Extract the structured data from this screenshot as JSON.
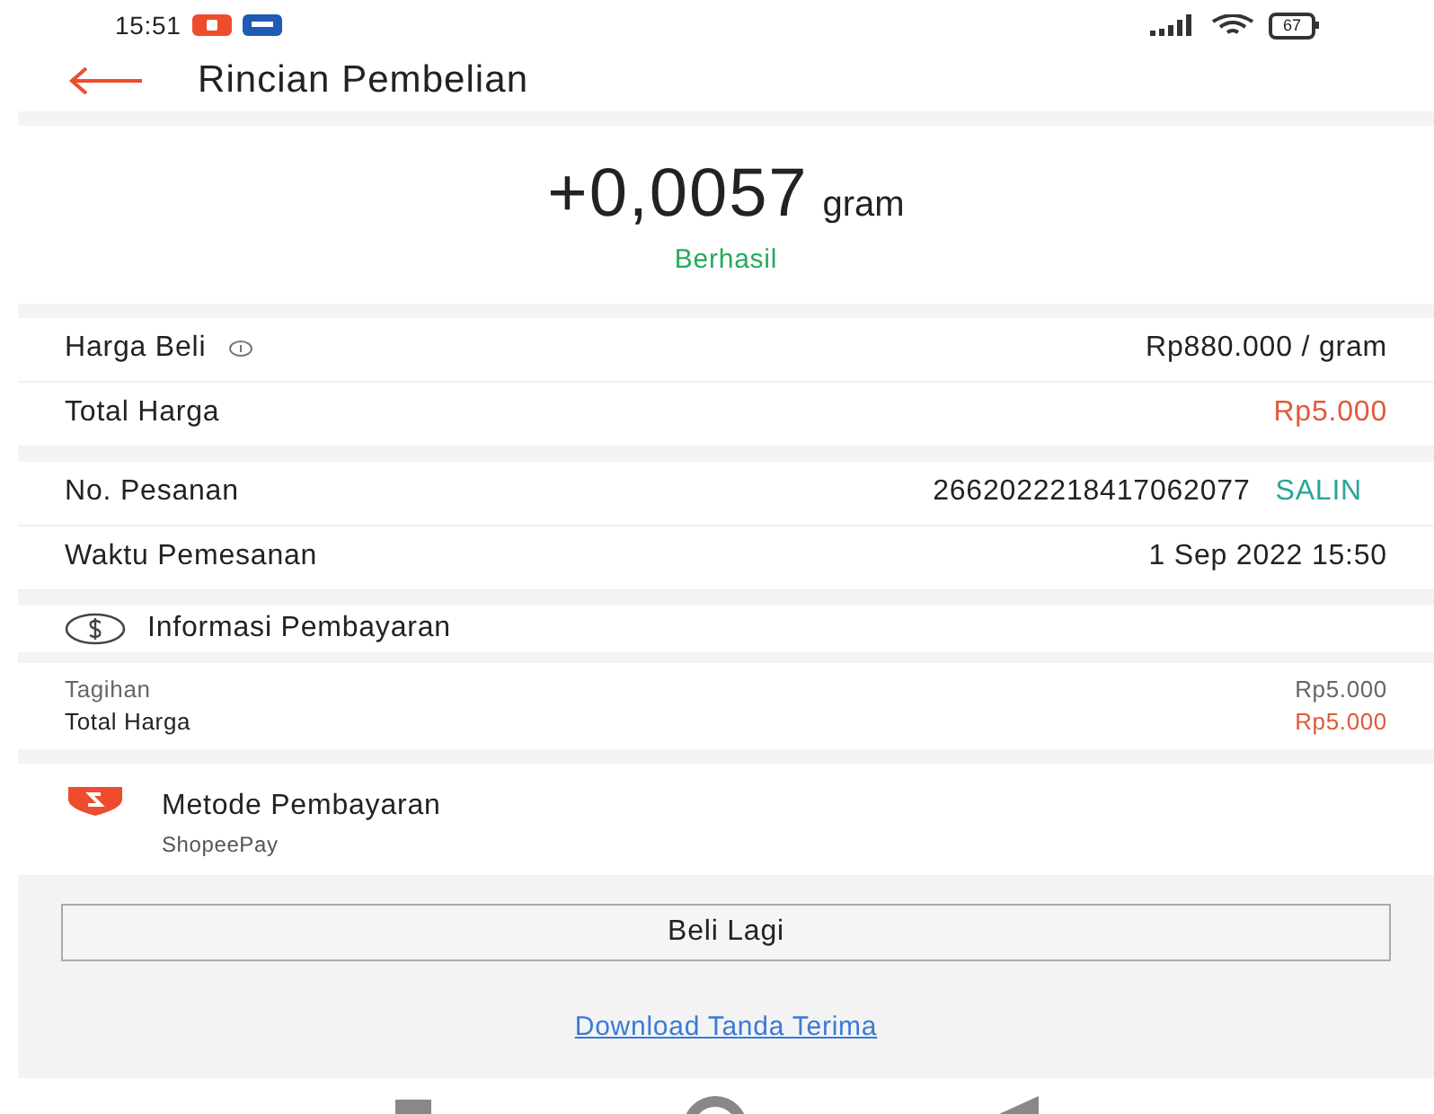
{
  "status_bar": {
    "time": "15:51",
    "battery": "67"
  },
  "header": {
    "title": "Rincian Pembelian"
  },
  "summary": {
    "amount": "+0,0057",
    "unit": "gram",
    "status": "Berhasil"
  },
  "price_rows": [
    {
      "label": "Harga Beli",
      "info": true,
      "value": "Rp880.000 / gram",
      "highlight": false
    },
    {
      "label": "Total Harga",
      "info": false,
      "value": "Rp5.000",
      "highlight": true
    }
  ],
  "order_rows": [
    {
      "label": "No. Pesanan",
      "value": "2662022218417062077",
      "action": "SALIN"
    },
    {
      "label": "Waktu Pemesanan",
      "value": "1 Sep 2022 15:50"
    }
  ],
  "payment_info": {
    "title": "Informasi Pembayaran",
    "rows": [
      {
        "label": "Tagihan",
        "value": "Rp5.000",
        "highlight": false
      },
      {
        "label": "Total Harga",
        "value": "Rp5.000",
        "highlight": true
      }
    ]
  },
  "payment_method": {
    "title": "Metode Pembayaran",
    "value": "ShopeePay"
  },
  "buy_again_button": "Beli Lagi",
  "receipt_link": "Download Tanda Terima"
}
